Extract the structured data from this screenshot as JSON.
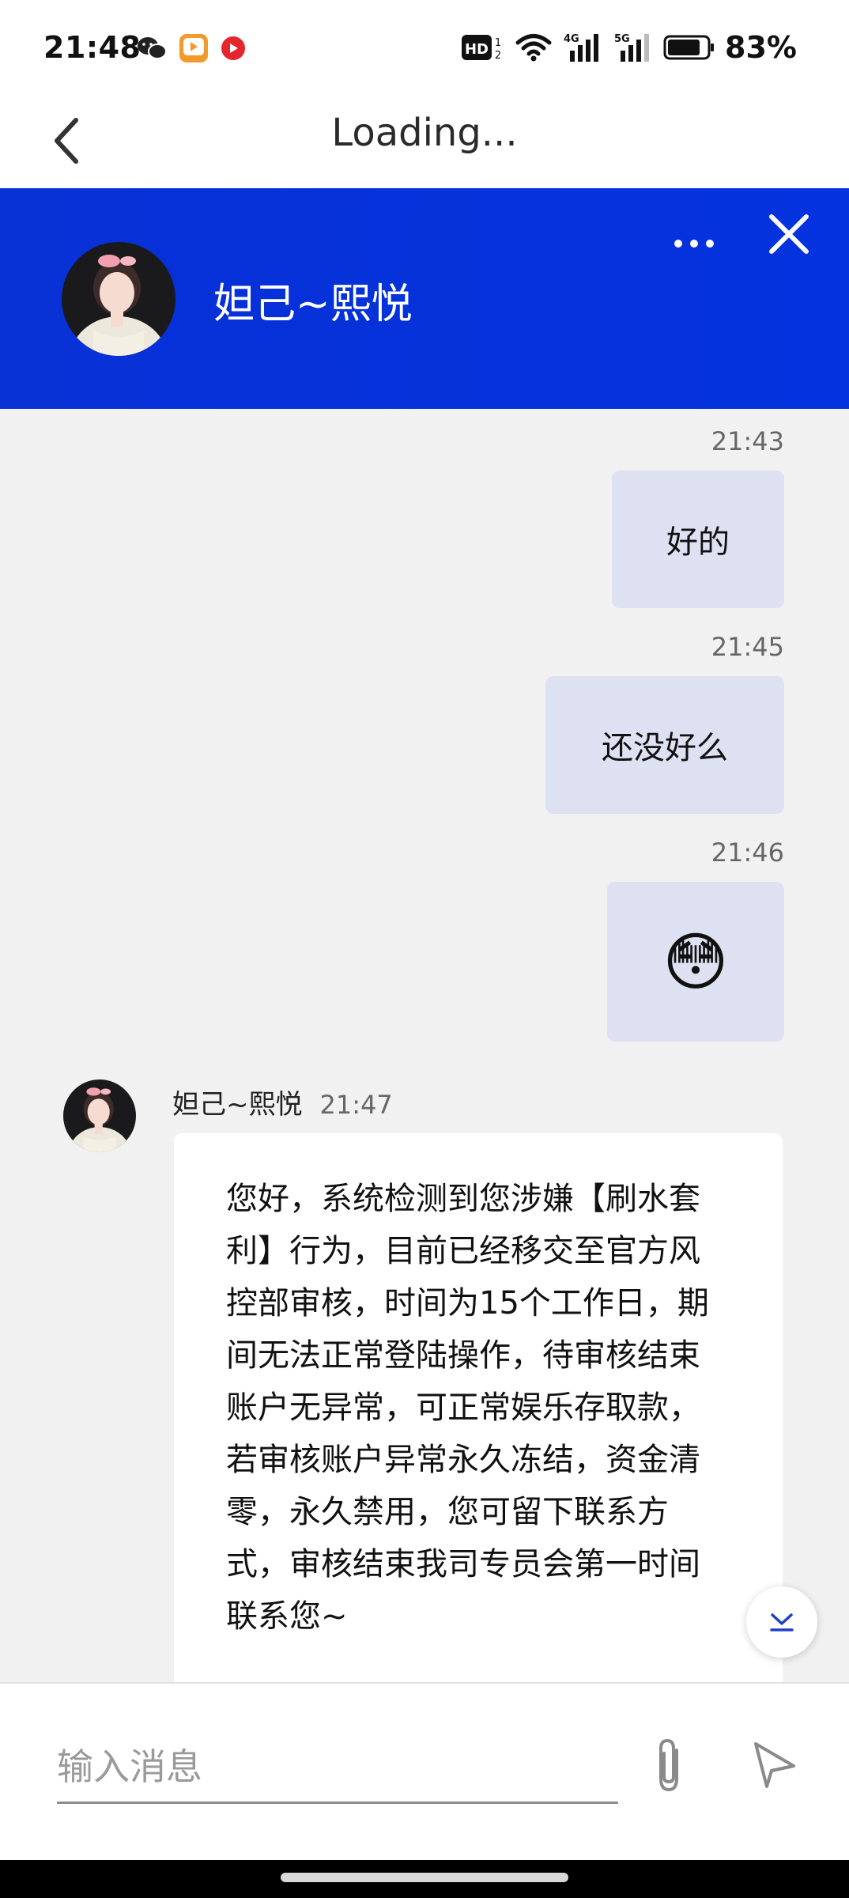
{
  "status_bar": {
    "time": "21:48",
    "battery": "83%",
    "network_labels": [
      "4G",
      "5G"
    ]
  },
  "title_bar": {
    "title": "Loading..."
  },
  "chat_header": {
    "contact_name": "妲己~熙悦"
  },
  "messages": [
    {
      "direction": "out",
      "time": "21:43",
      "text": "好的"
    },
    {
      "direction": "out",
      "time": "21:45",
      "text": "还没好么"
    },
    {
      "direction": "out",
      "time": "21:46",
      "text": "😳"
    },
    {
      "direction": "in",
      "sender": "妲己~熙悦",
      "time": "21:47",
      "lines": [
        "您好，系统检测到您涉嫌【刷水套",
        "利】行为，目前已经移交至官方风",
        "控部审核，时间为15个工作日，期",
        "间无法正常登陆操作，待审核结束",
        "账户无异常，可正常娱乐存取款，",
        "若审核账户异常永久冻结，资金清",
        "零，永久禁用，您可留下联系方",
        "式，审核结束我司专员会第一时间",
        "联系您~"
      ]
    }
  ],
  "input_bar": {
    "placeholder": "输入消息",
    "value": ""
  },
  "colors": {
    "header_blue": "#0432de",
    "outgoing_bubble": "#dde1f1",
    "incoming_bubble": "#ffffff",
    "background": "#f1f1f1"
  },
  "icons": [
    "back-arrow-icon",
    "more-icon",
    "close-icon",
    "scroll-down-icon",
    "attachment-icon",
    "send-icon",
    "wechat-icon",
    "video-app-icon",
    "record-app-icon",
    "hd-icon",
    "wifi-icon",
    "signal-icon",
    "battery-icon"
  ]
}
